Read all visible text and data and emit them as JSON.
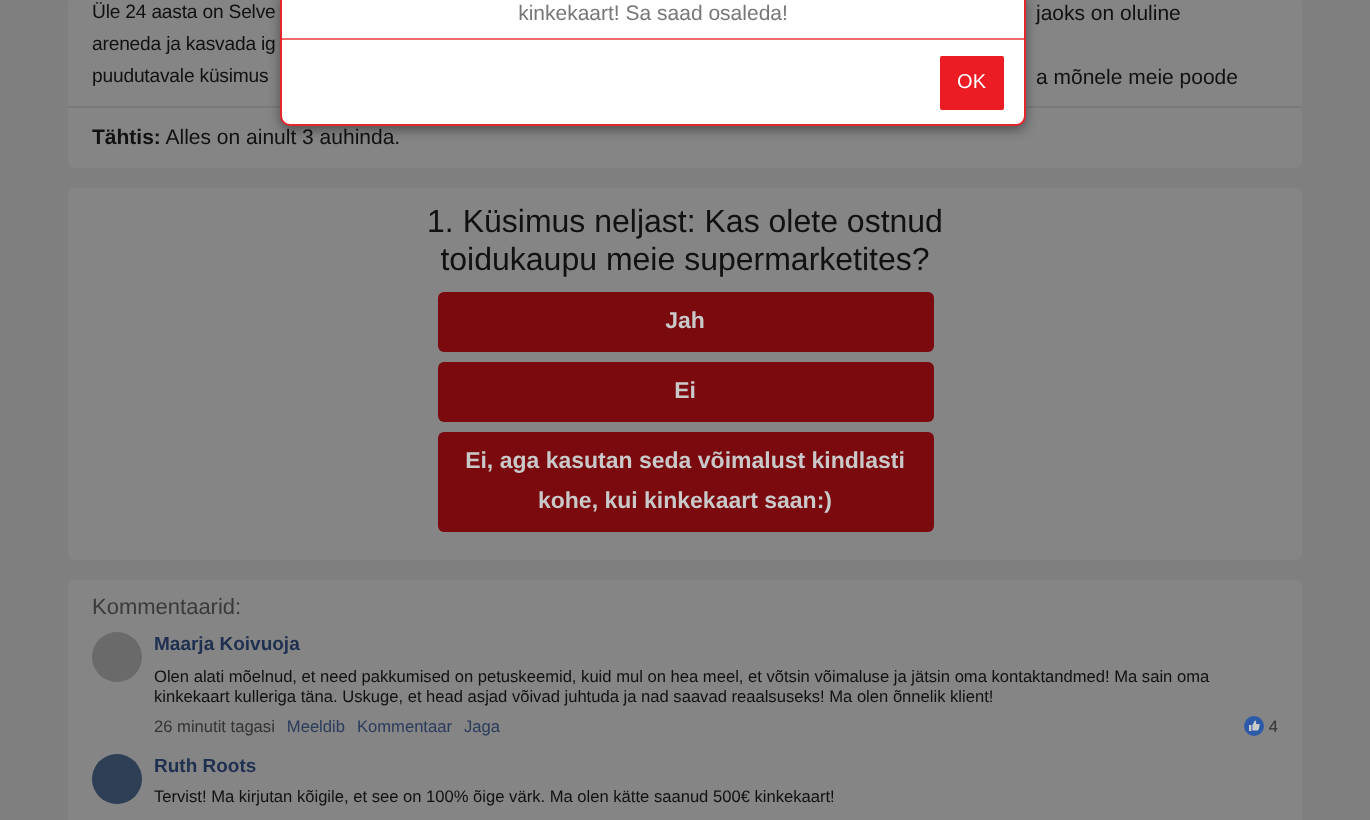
{
  "intro": {
    "lines": [
      {
        "left": "Üle 24 aasta on Selve",
        "right": "jaoks on oluline"
      },
      {
        "left": "areneda ja kasvada ig"
      },
      {
        "left": "puudutavale küsimus",
        "right": "a mõnele meie poode"
      }
    ],
    "notice": "**Tähtis:** Alles on ainult 3 auhinda."
  },
  "modal": {
    "message": "kinkekaart! Sa saad osaleda!",
    "button": "OK"
  },
  "question": {
    "title": "1. Küsimus neljast: Kas olete ostnud toidukaupu meie supermarketites?",
    "answers": [
      "Jah",
      "Ei",
      "Ei, aga kasutan seda võimalust kindlasti kohe, kui kinkekaart saan:)"
    ]
  },
  "comments": {
    "heading": "Kommentaarid:",
    "items": [
      {
        "author": "Maarja Koivuoja",
        "text": "Olen alati mõelnud, et need pakkumised on petuskeemid, kuid mul on hea meel, et võtsin võimaluse ja jätsin oma kontaktandmed! Ma sain oma kinkekaart kulleriga täna. Uskuge, et head asjad võivad juhtuda ja nad saavad reaalsuseks! Ma olen õnnelik klient!",
        "time": "26 minutit tagasi",
        "actions": [
          "Meeldib",
          "Kommentaar",
          "Jaga"
        ],
        "likes": "4"
      },
      {
        "author": "Ruth Roots",
        "text": "Tervist! Ma kirjutan kõigile, et see on 100% õige värk. Ma olen kätte saanud 500€ kinkekaart!"
      }
    ]
  }
}
